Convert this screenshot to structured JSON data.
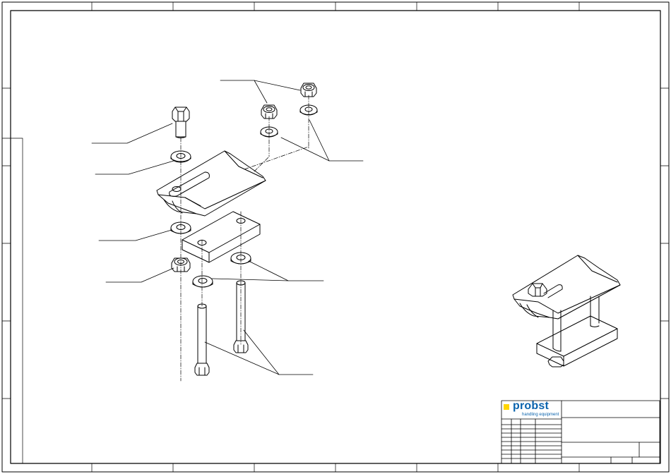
{
  "title_block": {
    "company_name": "probst",
    "company_tagline": "handling equipment",
    "brand_color": "#0a63ad",
    "accent_color": "#ffd500"
  },
  "drawing": {
    "style": "exploded isometric assembly line drawing",
    "callout_labels": []
  }
}
